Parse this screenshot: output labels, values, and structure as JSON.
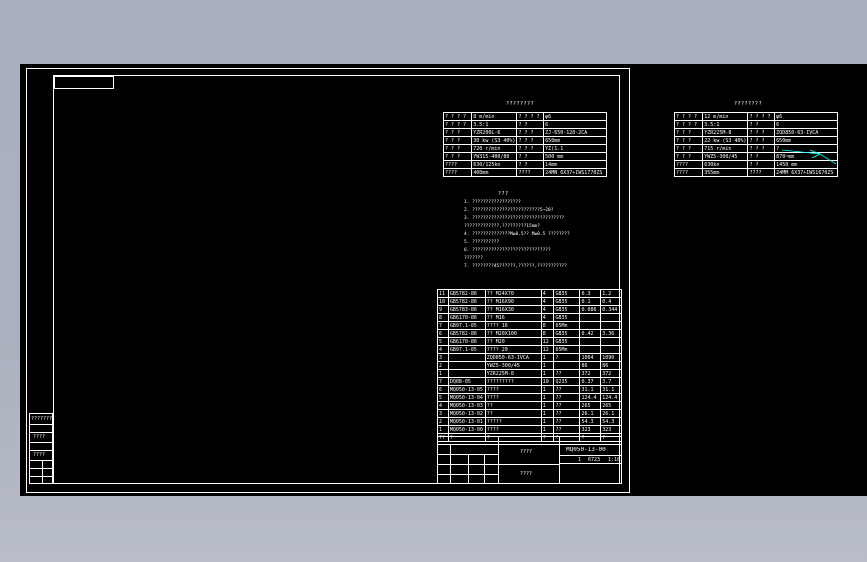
{
  "colors": {
    "background": "#a9b0bd",
    "canvas": "#000000",
    "line": "#ffffff",
    "accent": "#00ffff"
  },
  "main_table": {
    "title": "????????",
    "rows": [
      [
        "? ? ? ?",
        "8 m/min",
        "? ? ? ?",
        "φ6"
      ],
      [
        "? ? ? ?",
        "3.5:1",
        "? ?",
        "6"
      ],
      [
        "? ? ?",
        "YZR200L-6",
        "? ? ?",
        "ZJ-650-120-2CA"
      ],
      [
        "? ? ?",
        "30 kw (S3 40%)",
        "? ? ?",
        "650mm"
      ],
      [
        "? ? ?",
        "720 r/min",
        "? ? ?",
        "YZ(1.1"
      ],
      [
        "? ? ?",
        "YW315-400/80",
        "? ?",
        "500 mm"
      ],
      [
        "????",
        "630/125kn",
        "? ?",
        "14mm"
      ],
      [
        "????",
        "400mm",
        "????",
        "24MN 6X37+IWS1770ZS"
      ]
    ]
  },
  "second_table": {
    "title": "????????",
    "rows": [
      [
        "? ? ? ?",
        "12 m/min",
        "? ? ? ?",
        "φ6"
      ],
      [
        "? ? ? ?",
        "3.5:1",
        "? ?",
        "6"
      ],
      [
        "? ? ?",
        "YZR225M-8",
        "? ? ?",
        "ZQD850-63-IVCA"
      ],
      [
        "? ? ?",
        "22 kw (S3 40%)",
        "? ? ?",
        "650mm"
      ],
      [
        "? ? ?",
        "715 r/min",
        "? ? ?",
        "?"
      ],
      [
        "? ? ?",
        "YWZ5-300/45",
        "? ?",
        "870~mm"
      ],
      [
        "????",
        "630kn",
        "? ?",
        "1450 mm"
      ],
      [
        "????",
        "355mm",
        "????",
        "24MM 6X37+IWS1670ZS"
      ]
    ]
  },
  "notes": {
    "heading": "???",
    "lines": [
      "1. ??????????????????",
      "2. ?????????????????????????5~20?",
      "3. ??????????????????????????????????",
      "   ?????????????,?????????15mm?",
      "4. ??????????????M≥0.5?? M≥0.5 ????????",
      "5. ??????????",
      "6. ?????????????????????????????",
      "   ???????",
      "7. ????????45??????,??????,???????????"
    ]
  },
  "bom": {
    "rows": [
      [
        "11",
        "GB5782-86",
        "?? M24X70",
        "4",
        "GB35",
        "0.3",
        "1.2"
      ],
      [
        "10",
        "GB5782-86",
        "?? M16X90",
        "4",
        "GB35",
        "0.1",
        "0.4"
      ],
      [
        "9",
        "GB5783-86",
        "?? M16X30",
        "4",
        "GB35",
        "0.086",
        "0.344"
      ],
      [
        "8",
        "GB6170-86",
        "?? M16",
        "4",
        "GB35",
        "",
        " "
      ],
      [
        "7",
        "GB97.1-85",
        "???? 16",
        "8",
        "65Mn",
        "",
        ""
      ],
      [
        "6",
        "GB5782-86",
        "?? M20X100",
        "8",
        "GB35",
        "0.42",
        "3.36"
      ],
      [
        "5",
        "GB6170-86",
        "?? M20",
        "12",
        "GB35",
        "",
        ""
      ],
      [
        "4",
        "GB97.1-85",
        "???? 20",
        "12",
        "65Mn",
        "",
        ""
      ],
      [
        "3",
        "",
        "ZQD850-63-IVCA",
        "1",
        "?",
        "1064",
        "1090"
      ],
      [
        "2",
        "",
        "YWZ5-300/45",
        "1",
        "",
        "86",
        "86"
      ],
      [
        "1",
        "",
        "YZR225M-8",
        "1",
        "??",
        "372",
        "372"
      ],
      [
        "7",
        "DQ08-05",
        "?????????",
        "10",
        "Q235",
        "0.37",
        "3.7"
      ],
      [
        "6",
        "MQ050-13-05",
        "????",
        "1",
        "??",
        "31.1",
        "31.1"
      ],
      [
        "5",
        "MQ050-13-04",
        "????",
        "1",
        "??",
        "124.4",
        "124.4"
      ],
      [
        "4",
        "MQ050-13-03",
        "??",
        "1",
        "??",
        "265",
        "265"
      ],
      [
        "3",
        "MQ050-13-02",
        "??",
        "1",
        "??",
        "26.1",
        "26.1"
      ],
      [
        "2",
        "MQ050-13-01",
        "?????",
        "1",
        "??",
        "54.3",
        "54.3"
      ],
      [
        "1",
        "MQ050-13-00",
        "????",
        "1",
        "??",
        "323",
        "323"
      ]
    ],
    "header": [
      "??",
      "?",
      "?",
      "?",
      "?",
      "?",
      "?"
    ]
  },
  "title_block": {
    "drawing_no": "MQ050-13-00",
    "name": "????",
    "company": "????",
    "scale": "1:10",
    "weight": "6723",
    "sheet": "1"
  },
  "left_strip": {
    "items": [
      "???????",
      "",
      "????",
      "",
      "????",
      "",
      ""
    ]
  }
}
